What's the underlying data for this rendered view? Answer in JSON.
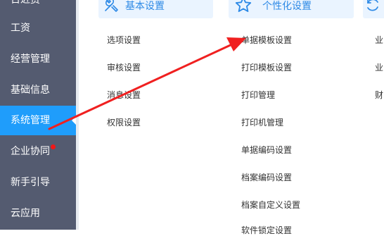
{
  "sidebar": {
    "items": [
      {
        "label": "日近赏"
      },
      {
        "label": "工资"
      },
      {
        "label": "经营管理"
      },
      {
        "label": "基础信息"
      },
      {
        "label": "系统管理",
        "active": true
      },
      {
        "label": "企业协同",
        "badge_dot": true
      },
      {
        "label": "新手引导"
      },
      {
        "label": "云应用"
      }
    ]
  },
  "columns": [
    {
      "title": "基本设置",
      "icon": "tools-icon",
      "links": [
        "选项设置",
        "审核设置",
        "消息设置",
        "权限设置"
      ]
    },
    {
      "title": "个性化设置",
      "icon": "star-icon",
      "links": [
        "单据模板设置",
        "打印模板设置",
        "打印管理",
        "打印机管理",
        "单据编码设置",
        "档案编码设置",
        "档案自定义设置",
        "软件锁定设置"
      ]
    },
    {
      "title": "",
      "icon": "cycle-icon",
      "links": [
        "业",
        "业",
        "财"
      ]
    }
  ],
  "colors": {
    "sidebar_bg": "#545b70",
    "active_bg": "#1f9dfb",
    "header_bg": "#eaf4ff",
    "header_text": "#2e8ae6",
    "annotation_arrow": "#f02020"
  }
}
